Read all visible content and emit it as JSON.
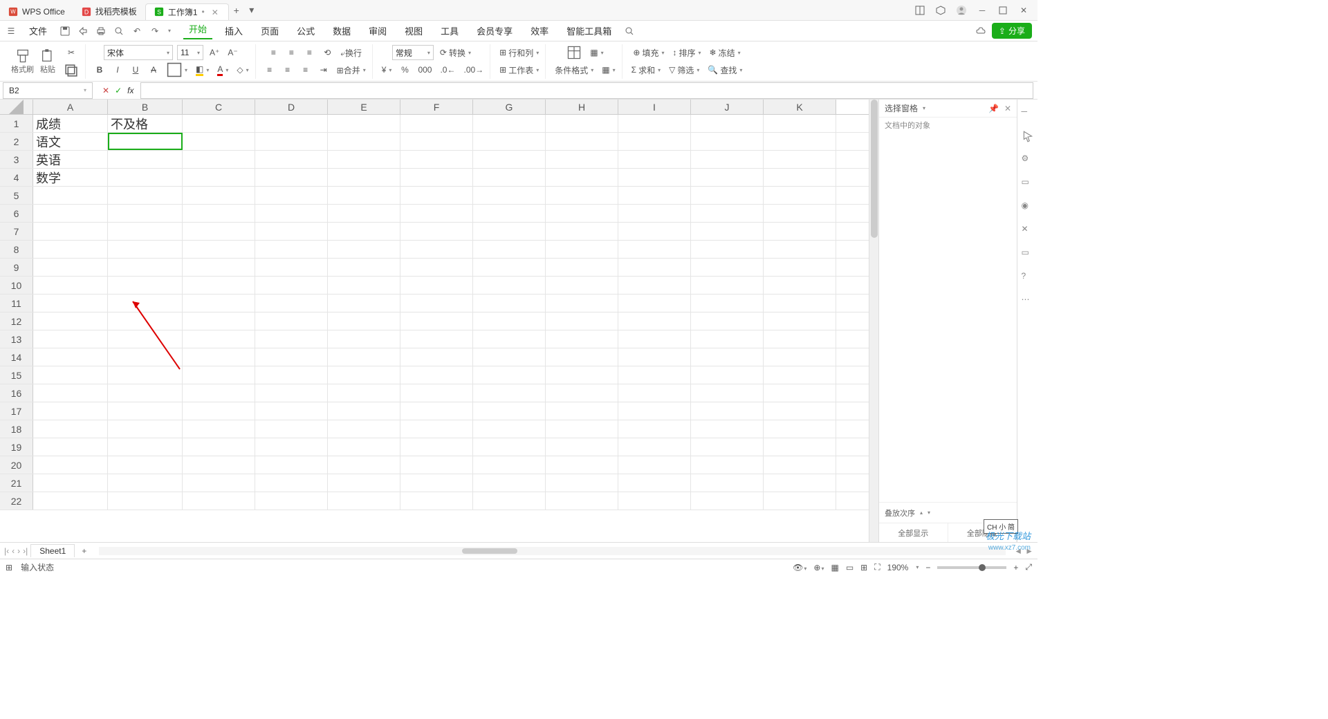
{
  "tabs": {
    "t1": "WPS Office",
    "t2": "找稻壳模板",
    "t3": "工作簿1"
  },
  "menu": {
    "file": "文件",
    "home": "开始",
    "insert": "插入",
    "page": "页面",
    "formula": "公式",
    "data": "数据",
    "review": "审阅",
    "view": "视图",
    "tools": "工具",
    "member": "会员专享",
    "efficiency": "效率",
    "smart": "智能工具箱"
  },
  "share": "分享",
  "ribbon": {
    "paintformat": "格式刷",
    "paste": "粘贴",
    "fontname": "宋体",
    "fontsize": "11",
    "general": "常规",
    "convert": "转换",
    "rowcol": "行和列",
    "worksheet": "工作表",
    "condformat": "条件格式",
    "fill": "填充",
    "sort": "排序",
    "freeze": "冻结",
    "sum": "求和",
    "filter": "筛选",
    "find": "查找"
  },
  "namebox": "B2",
  "columns": [
    "A",
    "B",
    "C",
    "D",
    "E",
    "F",
    "G",
    "H",
    "I",
    "J",
    "K"
  ],
  "rows_count": 22,
  "cells": {
    "A1": "成绩",
    "B1": "不及格",
    "A2": "语文",
    "A3": "英语",
    "A4": "数学"
  },
  "selected": "B2",
  "rightpanel": {
    "title": "选择窗格",
    "subtitle": "文档中的对象",
    "stack": "叠放次序",
    "showall": "全部显示",
    "hideall": "全部隐藏"
  },
  "sheet": "Sheet1",
  "status": {
    "label": "输入状态",
    "zoom": "190%"
  },
  "ime": "CH 小 简",
  "watermark": "极光下载站",
  "watermark_url": "www.xz7.com"
}
